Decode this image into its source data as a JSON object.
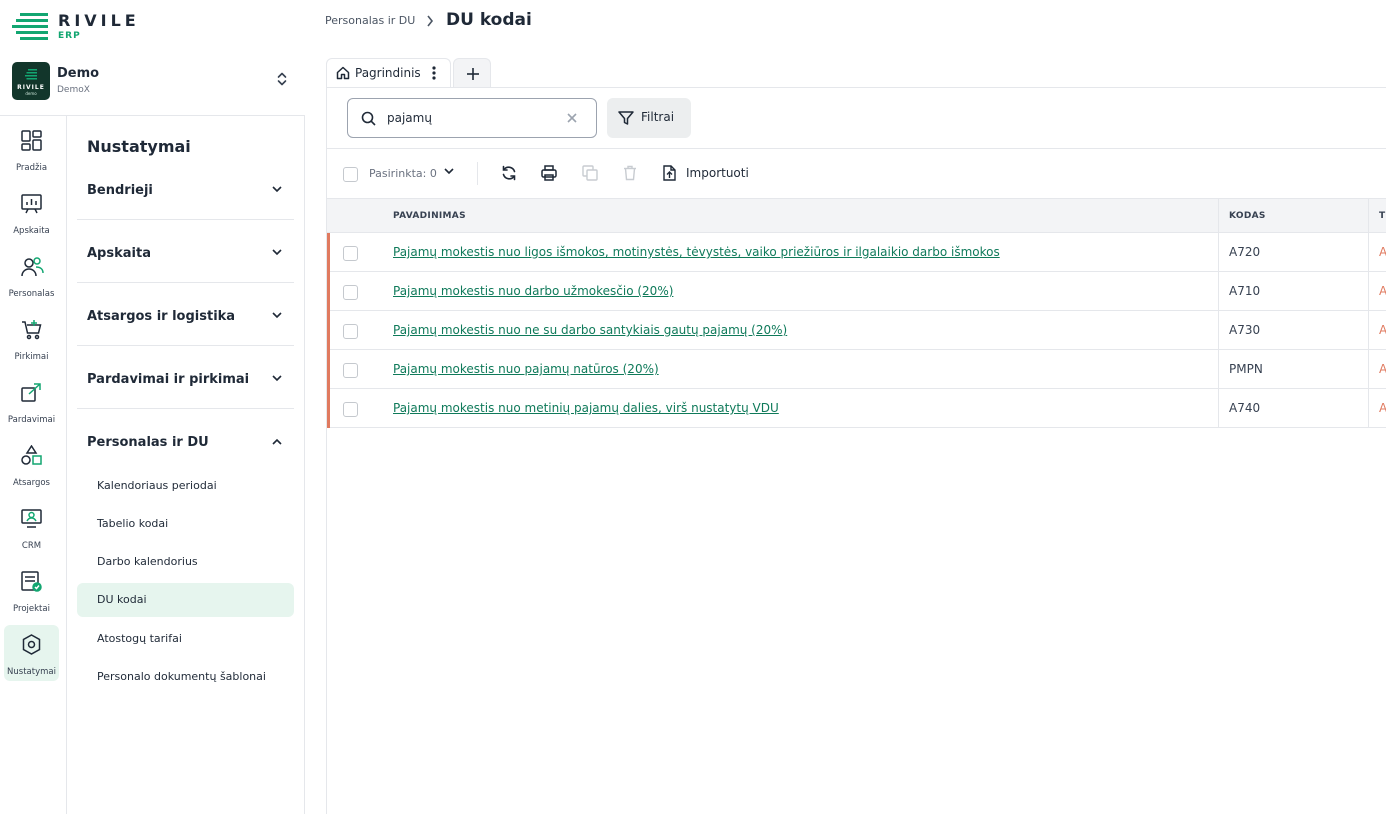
{
  "brand": {
    "name": "RIVILE",
    "sub": "ERP"
  },
  "workspace": {
    "name": "Demo",
    "sub": "DemoX",
    "avatar_text": "RIVILE",
    "avatar_sub": "demo"
  },
  "rail": [
    {
      "label": "Pradžia",
      "icon": "dashboard-icon"
    },
    {
      "label": "Apskaita",
      "icon": "chart-board-icon"
    },
    {
      "label": "Personalas",
      "icon": "people-icon"
    },
    {
      "label": "Pirkimai",
      "icon": "cart-icon"
    },
    {
      "label": "Pardavimai",
      "icon": "sales-icon"
    },
    {
      "label": "Atsargos",
      "icon": "shapes-icon"
    },
    {
      "label": "CRM",
      "icon": "crm-icon"
    },
    {
      "label": "Projektai",
      "icon": "projects-icon"
    },
    {
      "label": "Nustatymai",
      "icon": "settings-icon"
    }
  ],
  "panel": {
    "title": "Nustatymai",
    "sections": [
      {
        "label": "Bendrieji",
        "expanded": false
      },
      {
        "label": "Apskaita",
        "expanded": false
      },
      {
        "label": "Atsargos ir logistika",
        "expanded": false
      },
      {
        "label": "Pardavimai ir pirkimai",
        "expanded": false
      },
      {
        "label": "Personalas ir DU",
        "expanded": true
      }
    ],
    "subitems": [
      "Kalendoriaus periodai",
      "Tabelio kodai",
      "Darbo kalendorius",
      "DU kodai",
      "Atostogų tarifai",
      "Personalo dokumentų šablonai"
    ],
    "active_subitem": "DU kodai"
  },
  "breadcrumb": {
    "parent": "Personalas ir DU",
    "current": "DU kodai"
  },
  "tabs": [
    {
      "label": "Pagrindinis"
    }
  ],
  "search": {
    "value": "pajamų",
    "placeholder": ""
  },
  "filter_label": "Filtrai",
  "toolbar": {
    "selected_label": "Pasirinkta: 0",
    "import_label": "Importuoti"
  },
  "table": {
    "columns": [
      "PAVADINIMAS",
      "KODAS",
      "TI"
    ],
    "rows": [
      {
        "name": "Pajamų mokestis nuo ligos išmokos, motinystės, tėvystės, vaiko priežiūros ir ilgalaikio darbo išmokos",
        "code": "A720",
        "extra": "A"
      },
      {
        "name": "Pajamų mokestis nuo darbo užmokesčio (20%)",
        "code": "A710",
        "extra": "A"
      },
      {
        "name": "Pajamų mokestis nuo ne su darbo santykiais gautų pajamų (20%)",
        "code": "A730",
        "extra": "A"
      },
      {
        "name": "Pajamų mokestis nuo pajamų natūros (20%)",
        "code": "PMPN",
        "extra": "A"
      },
      {
        "name": "Pajamų mokestis nuo metinių pajamų dalies, virš nustatytų VDU",
        "code": "A740",
        "extra": "A"
      }
    ]
  },
  "colors": {
    "brand_green": "#12a671",
    "link_green": "#0f7a5a",
    "row_accent": "#e07a5f",
    "active_bg": "#e6f5ee"
  }
}
